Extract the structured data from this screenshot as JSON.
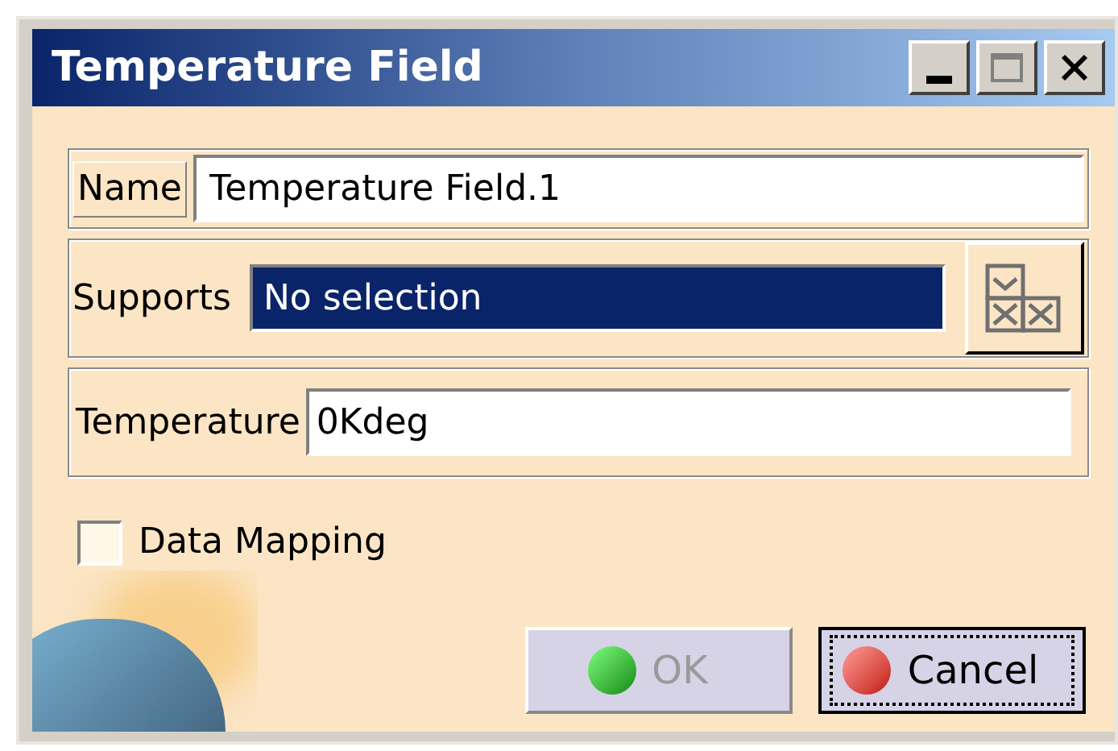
{
  "window": {
    "title": "Temperature Field"
  },
  "name": {
    "label": "Name",
    "value": "Temperature Field.1"
  },
  "supports": {
    "label": "Supports",
    "value": "No selection",
    "selected": true
  },
  "temperature": {
    "label": "Temperature",
    "value": "0Kdeg"
  },
  "data_mapping": {
    "label": "Data Mapping",
    "checked": false
  },
  "buttons": [
    {
      "label": "OK",
      "kind": "ok",
      "disabled": true,
      "focused": false
    },
    {
      "label": "Cancel",
      "kind": "cancel",
      "disabled": false,
      "focused": true
    }
  ]
}
